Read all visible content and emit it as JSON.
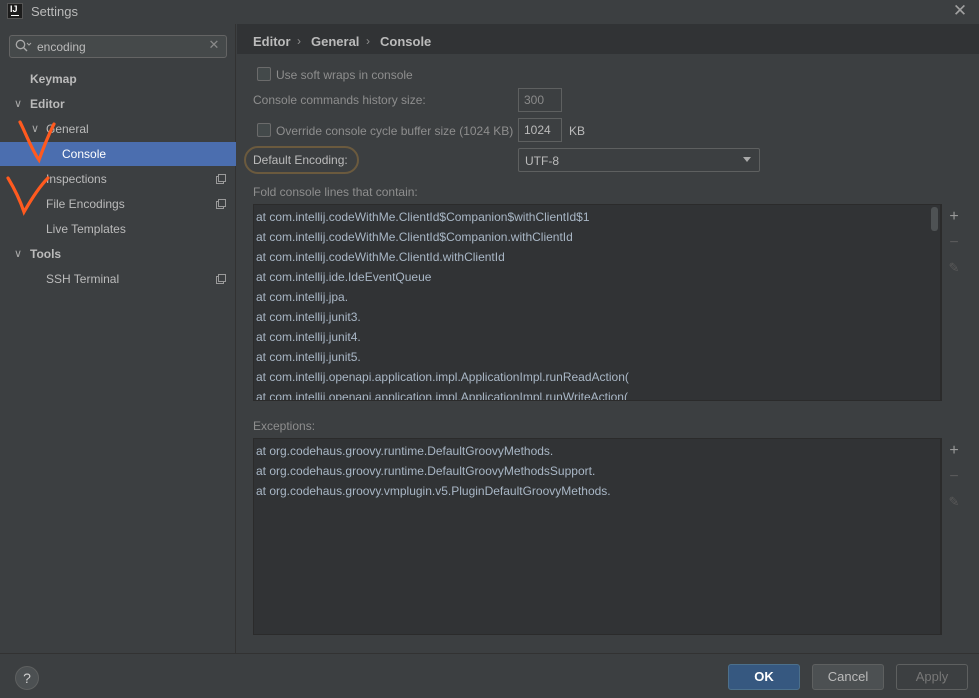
{
  "window": {
    "title": "Settings",
    "logo_text": "IJ",
    "close_glyph": "✕"
  },
  "search": {
    "value": "encoding",
    "clear_glyph": "✕"
  },
  "tree": [
    {
      "label": "Keymap",
      "bold": true
    },
    {
      "label": "Editor",
      "bold": true,
      "expanded": true
    },
    {
      "label": "General",
      "expanded": true
    },
    {
      "label": "Console",
      "selected": true
    },
    {
      "label": "Inspections",
      "project_icon": "copy-icon"
    },
    {
      "label": "File Encodings",
      "project_icon": "copy-icon"
    },
    {
      "label": "Live Templates"
    },
    {
      "label": "Tools",
      "bold": true,
      "expanded": true
    },
    {
      "label": "SSH Terminal",
      "project_icon": "copy-icon"
    }
  ],
  "breadcrumb": [
    "Editor",
    "General",
    "Console"
  ],
  "breadcrumb_sep": "›",
  "console": {
    "soft_wraps_label": "Use soft wraps in console",
    "history_label": "Console commands history size:",
    "history_value": "300",
    "cycle_buffer_label": "Override console cycle buffer size (1024 KB)",
    "cycle_buffer_value": "1024",
    "cycle_buffer_unit": "KB",
    "encoding_label": "Default Encoding:",
    "encoding_value": "UTF-8",
    "fold_label": "Fold console lines that contain:",
    "fold_lines": [
      "at com.intellij.codeWithMe.ClientId$Companion$withClientId$1",
      "at com.intellij.codeWithMe.ClientId$Companion.withClientId",
      "at com.intellij.codeWithMe.ClientId.withClientId",
      "at com.intellij.ide.IdeEventQueue",
      "at com.intellij.jpa.",
      "at com.intellij.junit3.",
      "at com.intellij.junit4.",
      "at com.intellij.junit5.",
      "at com.intellij.openapi.application.impl.ApplicationImpl.runReadAction(",
      "at com.intellij.openapi.application.impl.ApplicationImpl.runWriteAction("
    ],
    "exceptions_label": "Exceptions:",
    "exceptions": [
      "at org.codehaus.groovy.runtime.DefaultGroovyMethods.",
      "at org.codehaus.groovy.runtime.DefaultGroovyMethodsSupport.",
      "at org.codehaus.groovy.vmplugin.v5.PluginDefaultGroovyMethods."
    ]
  },
  "toolbar": {
    "add_glyph": "+",
    "remove_glyph": "−",
    "edit_glyph": "✎"
  },
  "footer": {
    "help_glyph": "?",
    "ok": "OK",
    "cancel": "Cancel",
    "apply": "Apply"
  },
  "colors": {
    "selection": "#4b6eaf",
    "annotation": "#ff5a1f",
    "ok_button": "#365880"
  }
}
